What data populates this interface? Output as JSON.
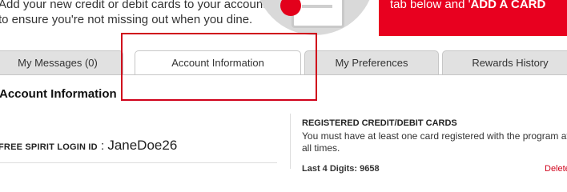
{
  "banner": {
    "left_text": "Add your new credit or debit cards to your account to ensure you're not missing out when you dine.",
    "right_text_prefix": "tab below and '",
    "right_text_bold": "ADD A CARD"
  },
  "tabs": [
    {
      "label": "My Messages (0)"
    },
    {
      "label": "Account Information"
    },
    {
      "label": "My Preferences"
    },
    {
      "label": "Rewards History"
    }
  ],
  "account": {
    "section_title": "Account Information",
    "login_label": "FREE SPIRIT LOGIN ID",
    "login_separator": " : ",
    "login_value": "JaneDoe26"
  },
  "cards": {
    "title": "REGISTERED CREDIT/DEBIT CARDS",
    "description": "You must have at least one card registered with the program at all times.",
    "last4_label": "Last 4 Digits: 9658",
    "delete_label": "Delete"
  },
  "colors": {
    "accent_red": "#e8001f",
    "highlight_red": "#d0021b"
  },
  "icons": {
    "card": "credit-card-icon",
    "badge": "alert-badge-icon"
  }
}
